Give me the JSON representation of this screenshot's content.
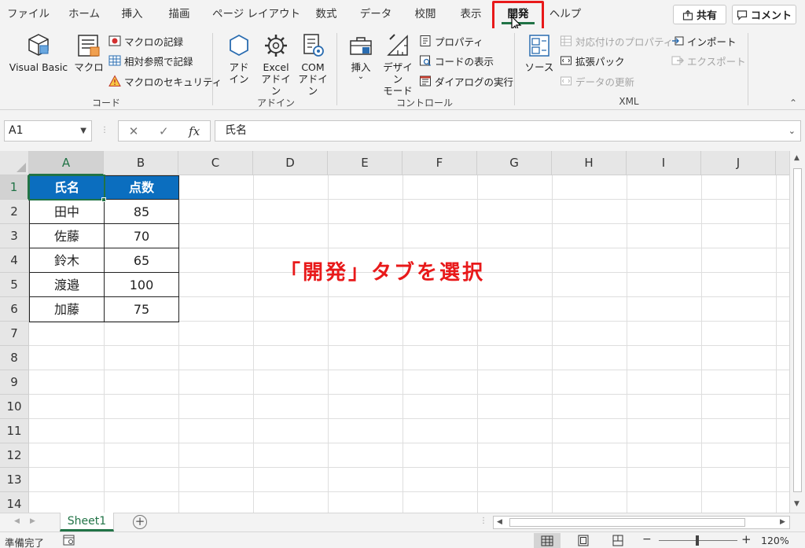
{
  "tabs": [
    {
      "label": "ファイル"
    },
    {
      "label": "ホーム"
    },
    {
      "label": "挿入"
    },
    {
      "label": "描画"
    },
    {
      "label": "ページ レイアウト"
    },
    {
      "label": "数式"
    },
    {
      "label": "データ"
    },
    {
      "label": "校閲"
    },
    {
      "label": "表示"
    },
    {
      "label": "開発"
    },
    {
      "label": "ヘルプ"
    }
  ],
  "header": {
    "share_label": "共有",
    "comment_label": "コメント"
  },
  "ribbon": {
    "code": {
      "group_label": "コード",
      "visual_basic": "Visual Basic",
      "macro": "マクロ",
      "record_macro": "マクロの記録",
      "relative_ref": "相対参照で記録",
      "macro_security": "マクロのセキュリティ"
    },
    "addins": {
      "group_label": "アドイン",
      "addin_l1": "アド",
      "addin_l2": "イン",
      "excel_l1": "Excel",
      "excel_l2": "アドイン",
      "com_l1": "COM",
      "com_l2": "アドイン"
    },
    "controls": {
      "group_label": "コントロール",
      "insert": "挿入",
      "design_l1": "デザイン",
      "design_l2": "モード",
      "properties": "プロパティ",
      "view_code": "コードの表示",
      "run_dialog": "ダイアログの実行"
    },
    "xml": {
      "group_label": "XML",
      "source": "ソース",
      "map_properties": "対応付けのプロパティ",
      "expansion_packs": "拡張パック",
      "refresh_data": "データの更新",
      "import": "インポート",
      "export": "エクスポート"
    }
  },
  "formula_bar": {
    "name_box": "A1",
    "fx": "fx",
    "formula": "氏名"
  },
  "columns": [
    "A",
    "B",
    "C",
    "D",
    "E",
    "F",
    "G",
    "H",
    "I",
    "J"
  ],
  "rows": [
    "1",
    "2",
    "3",
    "4",
    "5",
    "6",
    "7",
    "8",
    "9",
    "10",
    "11",
    "12",
    "13",
    "14"
  ],
  "table": {
    "headers": [
      "氏名",
      "点数"
    ],
    "rows": [
      [
        "田中",
        "85"
      ],
      [
        "佐藤",
        "70"
      ],
      [
        "鈴木",
        "65"
      ],
      [
        "渡邉",
        "100"
      ],
      [
        "加藤",
        "75"
      ]
    ]
  },
  "annotation": "「開発」タブを選択",
  "sheet": {
    "tab_label": "Sheet1",
    "add_label": "+"
  },
  "status": {
    "ready": "準備完了",
    "zoom": "120%",
    "minus": "−",
    "plus": "+"
  },
  "colors": {
    "accent": "#217346",
    "table_header": "#0b6ebf",
    "highlight": "#e8191a"
  }
}
